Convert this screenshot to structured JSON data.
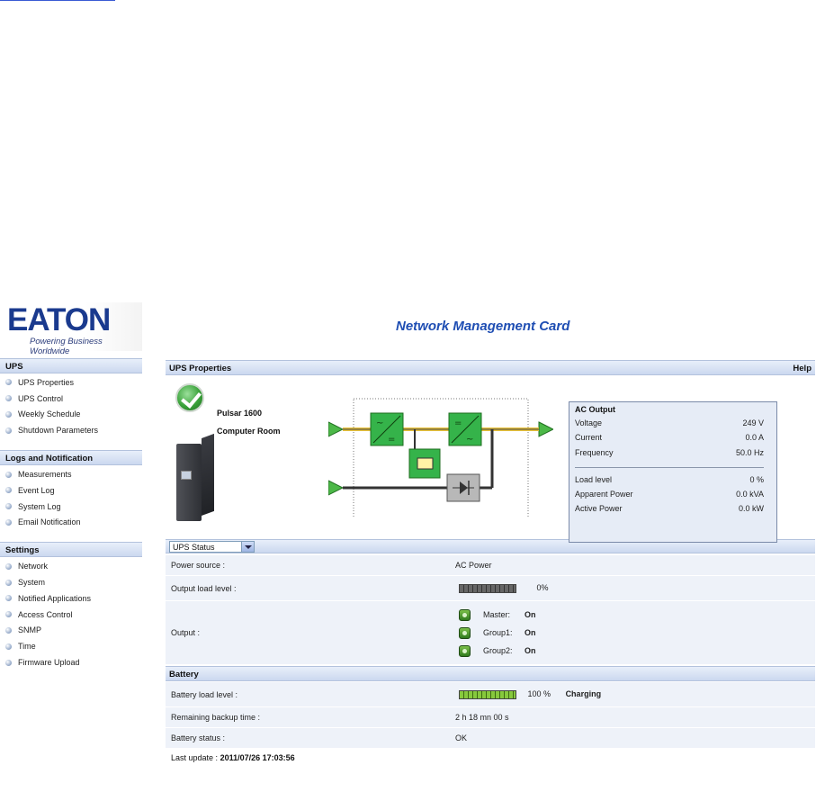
{
  "brand": {
    "logo_text": "EATON",
    "tagline": "Powering Business Worldwide"
  },
  "app_title": "Network Management Card",
  "nav": [
    {
      "header": "UPS",
      "items": [
        "UPS Properties",
        "UPS Control",
        "Weekly Schedule",
        "Shutdown Parameters"
      ]
    },
    {
      "header": "Logs and Notification",
      "items": [
        "Measurements",
        "Event Log",
        "System Log",
        "Email Notification"
      ]
    },
    {
      "header": "Settings",
      "items": [
        "Network",
        "System",
        "Notified Applications",
        "Access Control",
        "SNMP",
        "Time",
        "Firmware Upload"
      ]
    }
  ],
  "panel": {
    "title": "UPS Properties",
    "help": "Help"
  },
  "ups": {
    "model": "Pulsar 1600",
    "location": "Computer Room"
  },
  "ac_output": {
    "title": "AC Output",
    "rows1": [
      {
        "label": "Voltage",
        "value": "249 V"
      },
      {
        "label": "Current",
        "value": "0.0 A"
      },
      {
        "label": "Frequency",
        "value": "50.0 Hz"
      }
    ],
    "rows2": [
      {
        "label": "Load level",
        "value": "0 %"
      },
      {
        "label": "Apparent Power",
        "value": "0.0 kVA"
      },
      {
        "label": "Active Power",
        "value": "0.0 kW"
      }
    ]
  },
  "status_select": {
    "selected": "UPS Status"
  },
  "status": {
    "power_source_label": "Power source :",
    "power_source_value": "AC Power",
    "output_load_label": "Output load level :",
    "output_load_value": "0%",
    "output_load_fraction": 0,
    "output_label": "Output :",
    "outputs": [
      {
        "name": "Master:",
        "state": "On"
      },
      {
        "name": "Group1:",
        "state": "On"
      },
      {
        "name": "Group2:",
        "state": "On"
      }
    ]
  },
  "battery": {
    "header": "Battery",
    "load_label": "Battery load level :",
    "load_value": "100 %",
    "load_fraction": 1.0,
    "charging": "Charging",
    "backup_label": "Remaining backup time :",
    "backup_value": "2 h 18 mn 00 s",
    "status_label": "Battery status :",
    "status_value": "OK"
  },
  "last_update": {
    "label": "Last update :",
    "value": "2011/07/26 17:03:56"
  },
  "colors": {
    "accent": "#1f4eb3",
    "module_green": "#35b34a",
    "flow_yellow": "#e8c23a"
  }
}
